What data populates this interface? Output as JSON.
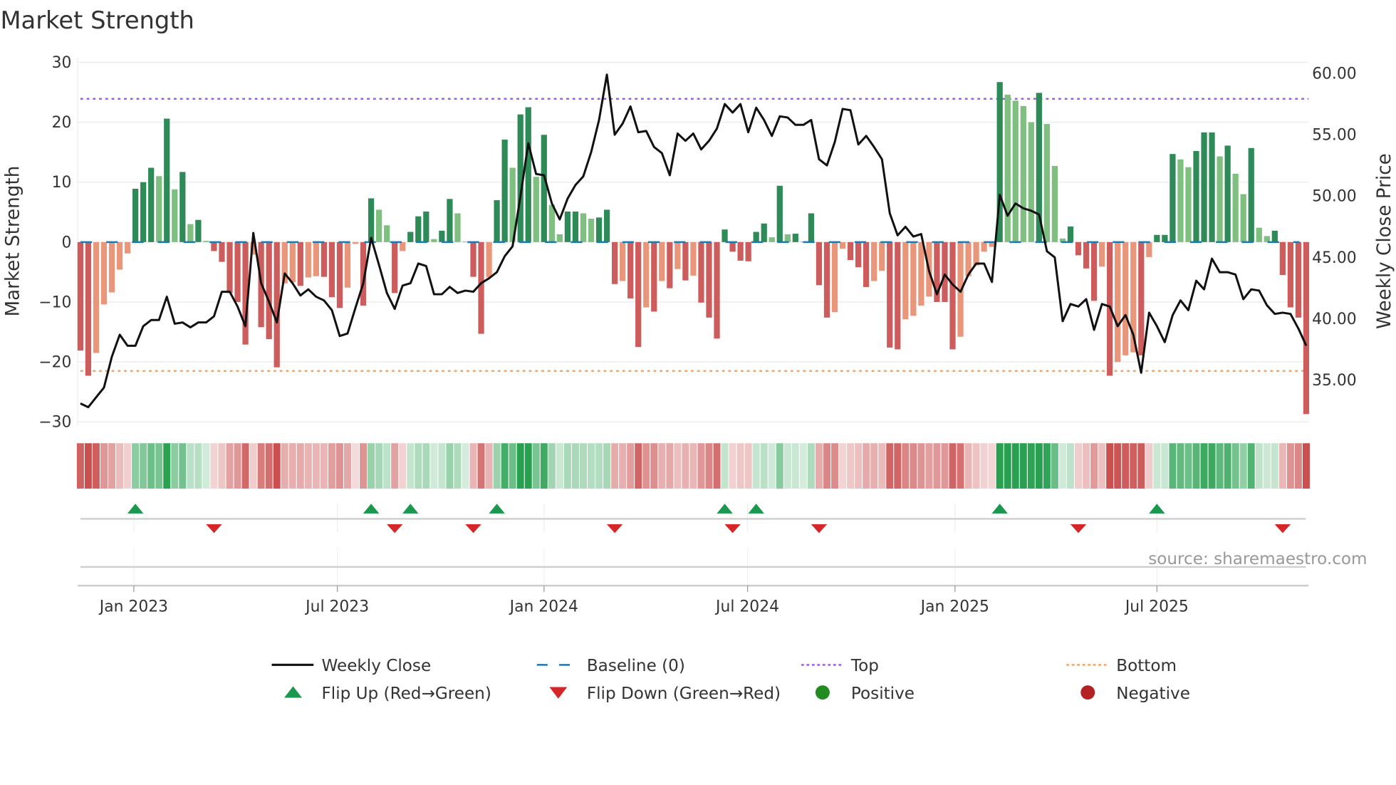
{
  "chart_data": {
    "type": "bar",
    "title": "Market Strength",
    "ylabel": "Market Strength",
    "y2label": "Weekly Close Price",
    "ylim": [
      -30,
      30
    ],
    "y2lim": [
      31.6,
      60.9
    ],
    "yticks": [
      "30",
      "20",
      "10",
      "0",
      "−10",
      "−20",
      "−30"
    ],
    "ytick_values": [
      30,
      20,
      10,
      0,
      -10,
      -20,
      -30
    ],
    "y2ticks": [
      "60.00",
      "55.00",
      "50.00",
      "45.00",
      "40.00",
      "35.00"
    ],
    "y2tick_values": [
      60,
      55,
      50,
      45,
      40,
      35
    ],
    "x_unit": "week index",
    "xticks": [
      {
        "label": "Jan 2023",
        "week": 6.8
      },
      {
        "label": "Jul 2023",
        "week": 32.7
      },
      {
        "label": "Jan 2024",
        "week": 59.0
      },
      {
        "label": "Jul 2024",
        "week": 84.9
      },
      {
        "label": "Jan 2025",
        "week": 111.3
      },
      {
        "label": "Jul 2025",
        "week": 137.0
      }
    ],
    "top": 23.9,
    "bottom": -21.5,
    "baseline": 0,
    "strength": [
      -18.1,
      -22.3,
      -18.5,
      -10.4,
      -8.4,
      -4.6,
      -1.9,
      8.9,
      10.0,
      12.4,
      11.0,
      20.6,
      8.8,
      11.7,
      3.0,
      3.7,
      0.2,
      -1.5,
      -3.3,
      -8.5,
      -10.0,
      -17.1,
      -2.1,
      -14.2,
      -16.2,
      -20.9,
      -6.9,
      -6.7,
      -7.3,
      -5.9,
      -5.7,
      -5.8,
      -9.2,
      -11.0,
      -7.6,
      -0.3,
      -10.6,
      7.3,
      5.4,
      2.8,
      -8.5,
      -1.5,
      1.7,
      4.3,
      5.1,
      0.5,
      1.9,
      7.2,
      4.8,
      0.1,
      -5.8,
      -15.3,
      -5.9,
      7.0,
      17.1,
      12.4,
      21.3,
      22.5,
      10.9,
      17.9,
      6.2,
      1.3,
      5.1,
      5.1,
      4.8,
      3.9,
      4.1,
      5.4,
      -7.0,
      -6.5,
      -9.4,
      -17.5,
      -10.9,
      -11.6,
      -6.5,
      -7.7,
      -4.5,
      -6.4,
      -5.6,
      -10.1,
      -12.6,
      -16.1,
      2.1,
      -1.6,
      -3.1,
      -3.2,
      1.7,
      3.1,
      0.8,
      9.4,
      1.3,
      1.4,
      0.1,
      4.8,
      -7.2,
      -12.6,
      -11.7,
      -1.1,
      -3.0,
      -4.2,
      -7.5,
      -6.5,
      -4.8,
      -17.6,
      -17.9,
      -12.9,
      -12.3,
      -10.6,
      -9.1,
      -10.0,
      -10.0,
      -17.9,
      -15.8,
      -5.7,
      -3.9,
      -1.6,
      -0.8,
      26.7,
      24.6,
      23.6,
      22.7,
      20.0,
      24.9,
      19.7,
      12.7,
      0.6,
      2.6,
      -2.2,
      -4.4,
      -9.8,
      -4.1,
      -22.3,
      -20.0,
      -18.9,
      -18.4,
      -18.9,
      -2.5,
      1.2,
      1.2,
      14.7,
      13.8,
      12.5,
      15.2,
      18.3,
      18.3,
      14.3,
      16.1,
      11.4,
      8.0,
      15.7,
      2.4,
      1.0,
      1.9,
      -5.5,
      -10.9,
      -12.6,
      -28.7
    ],
    "weekly_close": [
      33.1,
      32.8,
      33.6,
      34.4,
      36.9,
      38.7,
      37.8,
      37.8,
      39.4,
      39.9,
      39.9,
      41.8,
      39.6,
      39.7,
      39.3,
      39.7,
      39.7,
      40.2,
      42.2,
      42.2,
      41.0,
      39.4,
      47.0,
      42.9,
      41.4,
      39.7,
      43.7,
      42.9,
      41.9,
      42.4,
      41.8,
      41.5,
      40.7,
      38.6,
      38.8,
      40.9,
      42.9,
      46.6,
      44.4,
      42.1,
      40.8,
      42.7,
      42.9,
      44.5,
      44.3,
      42.0,
      42.0,
      42.6,
      42.1,
      42.3,
      42.2,
      42.9,
      43.3,
      43.8,
      45.1,
      45.9,
      50.0,
      54.3,
      51.8,
      51.7,
      49.4,
      48.1,
      49.8,
      50.9,
      51.6,
      53.6,
      56.2,
      59.9,
      55.0,
      55.9,
      57.3,
      55.2,
      55.3,
      54.0,
      53.5,
      51.7,
      55.1,
      54.5,
      55.1,
      53.8,
      54.5,
      55.5,
      57.5,
      56.8,
      57.5,
      55.2,
      57.2,
      56.2,
      54.9,
      56.5,
      56.4,
      55.8,
      55.8,
      56.2,
      53.0,
      52.5,
      54.4,
      57.1,
      57.0,
      54.2,
      54.9,
      54.0,
      53.0,
      48.6,
      46.8,
      47.5,
      46.7,
      46.9,
      43.9,
      42.0,
      43.6,
      42.8,
      42.2,
      43.6,
      44.5,
      44.5,
      43.0,
      50.1,
      48.4,
      49.4,
      49.0,
      48.8,
      48.5,
      45.5,
      45.0,
      39.8,
      41.2,
      41.0,
      41.6,
      39.1,
      41.2,
      41.0,
      39.4,
      40.3,
      38.7,
      35.6,
      40.5,
      39.4,
      38.1,
      40.3,
      41.5,
      40.7,
      43.1,
      42.4,
      44.9,
      43.8,
      43.8,
      43.6,
      41.6,
      42.4,
      42.3,
      41.1,
      40.4,
      40.5,
      40.4,
      39.2,
      37.8
    ],
    "flip_up_weeks": [
      7,
      37,
      42,
      53,
      82,
      86,
      117,
      137
    ],
    "flip_down_weeks": [
      17,
      40,
      50,
      68,
      83,
      94,
      127,
      153
    ],
    "legend": {
      "placement": "bottom",
      "items": [
        {
          "label": "Weekly Close",
          "kind": "line"
        },
        {
          "label": "Baseline (0)",
          "kind": "dash"
        },
        {
          "label": "Top",
          "kind": "dot-purple"
        },
        {
          "label": "Bottom",
          "kind": "dot-orange"
        },
        {
          "label": "Flip Up (Red→Green)",
          "kind": "tri-up"
        },
        {
          "label": "Flip Down (Green→Red)",
          "kind": "tri-down"
        },
        {
          "label": "Positive",
          "kind": "dot-green"
        },
        {
          "label": "Negative",
          "kind": "dot-red"
        }
      ]
    },
    "source": "source: sharemaestro.com"
  },
  "colors": {
    "pos_rising": "#2e8b57",
    "pos_falling": "#7fbf7f",
    "neg_falling": "#cd5c5c",
    "neg_rising": "#e9967a",
    "close_line": "#111111",
    "baseline": "#1f77b4",
    "top": "#9b5de5",
    "bottom": "#f4a261",
    "flip_up": "#1a9850",
    "flip_down": "#d62728",
    "positive": "#228b22",
    "negative": "#b22222"
  }
}
